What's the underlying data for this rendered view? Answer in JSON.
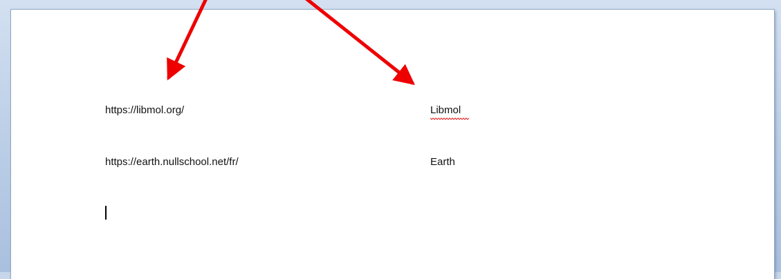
{
  "document": {
    "lines": [
      {
        "link_text": "https://libmol.org/",
        "label": "Libmol"
      },
      {
        "link_text": "https://earth.nullschool.net/fr/",
        "label": "Earth"
      }
    ]
  },
  "colors": {
    "annotation_arrow": "#ee0000",
    "spelling_underline": "#e02020",
    "page_background": "#ffffff",
    "workspace_background": "#bccfe7"
  }
}
